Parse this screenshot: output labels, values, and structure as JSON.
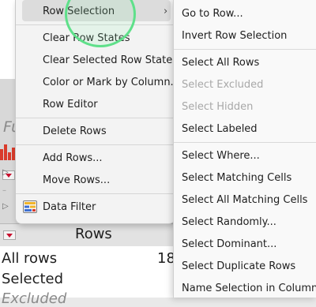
{
  "background": {
    "filter_hint": "Fu",
    "rows_panel": {
      "title": "Rows",
      "lines": [
        {
          "label": "All rows",
          "value": "18"
        },
        {
          "label": "Selected",
          "value": ""
        },
        {
          "label": "Excluded",
          "value": ""
        }
      ]
    }
  },
  "context_menu": {
    "items": [
      {
        "label": "Row Selection",
        "has_submenu": true,
        "highlighted": true
      },
      {
        "label": "Clear Row States"
      },
      {
        "label": "Clear Selected Row States"
      },
      {
        "label": "Color or Mark by Column..."
      },
      {
        "label": "Row Editor"
      },
      {
        "label": "Delete Rows"
      },
      {
        "label": "Add Rows..."
      },
      {
        "label": "Move Rows..."
      },
      {
        "label": "Data Filter",
        "icon": "data-filter-icon"
      }
    ],
    "chevron_glyph": "›"
  },
  "submenu": {
    "items": [
      {
        "label": "Go to Row..."
      },
      {
        "label": "Invert Row Selection"
      },
      {
        "label": "Select All Rows"
      },
      {
        "label": "Select Excluded",
        "disabled": true
      },
      {
        "label": "Select Hidden",
        "disabled": true
      },
      {
        "label": "Select Labeled"
      },
      {
        "label": "Select Where..."
      },
      {
        "label": "Select Matching Cells"
      },
      {
        "label": "Select All Matching Cells"
      },
      {
        "label": "Select Randomly..."
      },
      {
        "label": "Select Dominant..."
      },
      {
        "label": "Select Duplicate Rows"
      },
      {
        "label": "Name Selection in Column..."
      }
    ]
  },
  "colors": {
    "accent_red": "#c8102e",
    "cursor_ring": "#5fe08a",
    "disabled_text": "#a8a8a8"
  }
}
